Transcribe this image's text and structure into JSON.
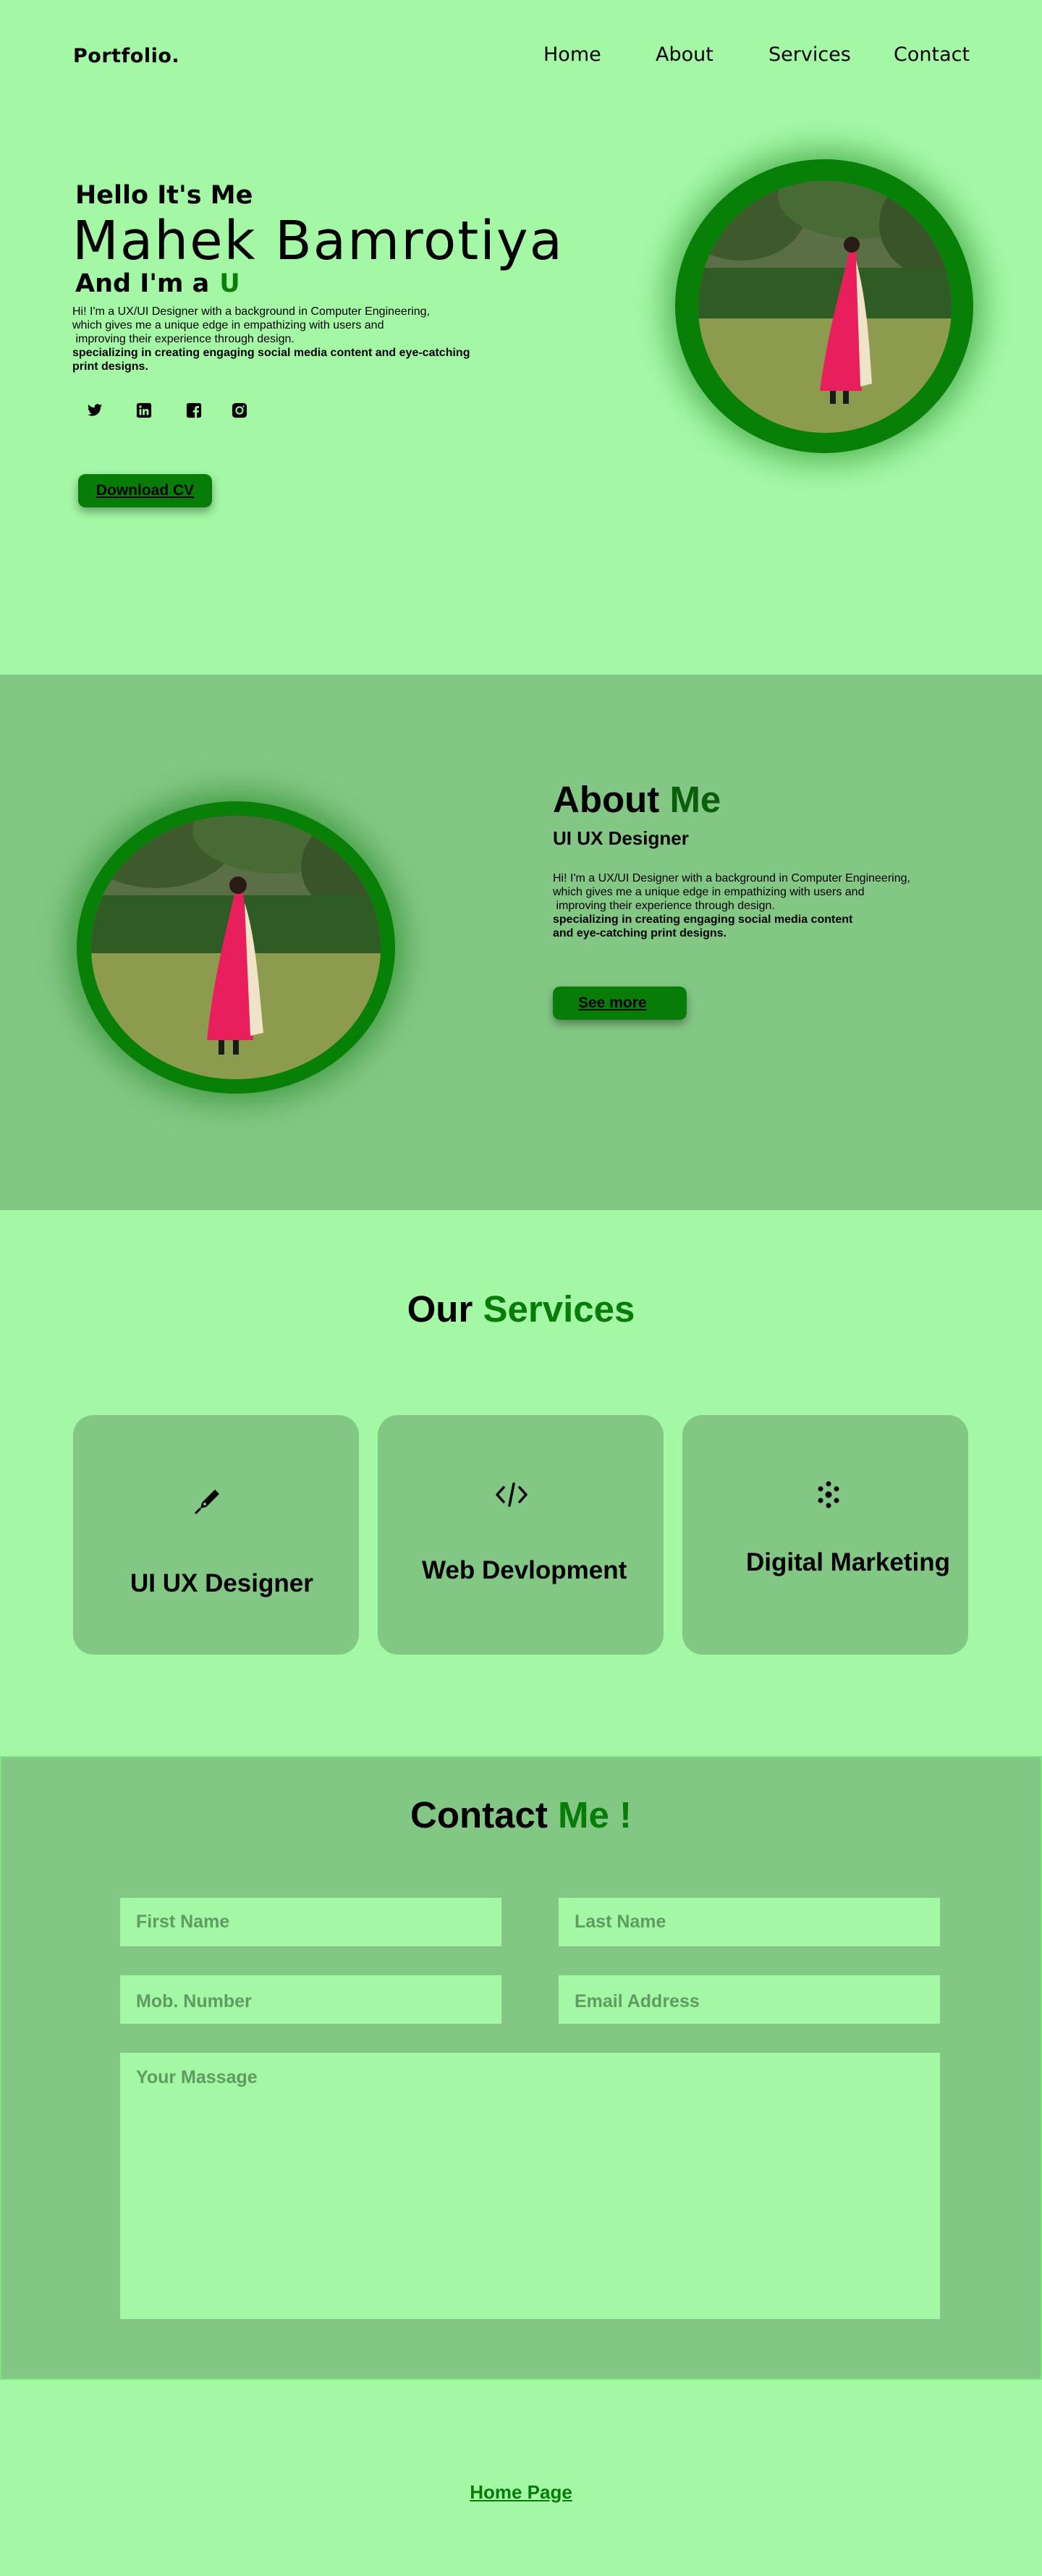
{
  "nav": {
    "logo": "Portfolio.",
    "links": [
      "Home",
      "About",
      "Services",
      "Contact"
    ]
  },
  "hero": {
    "greeting": "Hello It's Me",
    "name": "Mahek Bamrotiya",
    "role_prefix": "And I'm a",
    "role_typed": "U",
    "desc_lines": [
      "Hi! I'm a UX/UI Designer with a background in Computer Engineering,",
      "which gives me a unique edge in empathizing with users and",
      " improving their experience through design."
    ],
    "desc_bold": "specializing in creating engaging social media content and eye-catching print designs.",
    "socials": [
      "twitter-icon",
      "linkedin-icon",
      "facebook-icon",
      "instagram-icon"
    ],
    "cta": "Download CV"
  },
  "about": {
    "title_main": "About",
    "title_accent": "Me",
    "subtitle": "UI UX Designer",
    "desc_lines": [
      "Hi! I'm a UX/UI Designer with a background in Computer Engineering,",
      "which gives me a unique edge in empathizing with users and",
      " improving their experience through design."
    ],
    "desc_bold": "specializing in creating engaging social media content and eye-catching print designs.",
    "cta": "See more"
  },
  "services": {
    "title_main": "Our",
    "title_accent": "Services",
    "cards": [
      {
        "icon": "pen-nib-icon",
        "label": "UI UX Designer"
      },
      {
        "icon": "code-icon",
        "label": "Web Devlopment"
      },
      {
        "icon": "network-icon",
        "label": "Digital Marketing"
      }
    ]
  },
  "contact": {
    "title_main": "Contact",
    "title_accent": "Me !",
    "first_name_placeholder": "First Name",
    "last_name_placeholder": "Last Name",
    "mobile_placeholder": "Mob. Number",
    "email_placeholder": "Email Address",
    "message_placeholder": "Your Massage"
  },
  "footer": {
    "home_link": "Home Page"
  },
  "colors": {
    "page_bg": "#a3f7a5",
    "section_bg": "#83c785",
    "accent": "#077d07"
  }
}
